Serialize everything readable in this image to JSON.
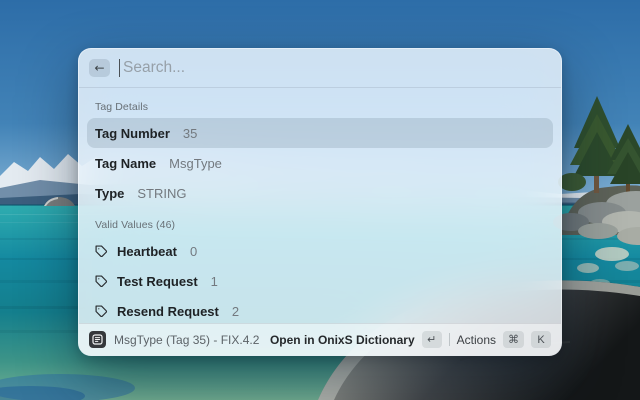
{
  "window": {
    "search": {
      "placeholder": "Search..."
    },
    "icons": {
      "back": "←",
      "return_key": "↵",
      "command_key": "⌘"
    },
    "tag_details": {
      "header": "Tag Details",
      "rows": [
        {
          "label": "Tag Number",
          "value": "35"
        },
        {
          "label": "Tag Name",
          "value": "MsgType"
        },
        {
          "label": "Type",
          "value": "STRING"
        }
      ]
    },
    "valid_values": {
      "header": "Valid Values (46)",
      "items": [
        {
          "label": "Heartbeat",
          "value": "0"
        },
        {
          "label": "Test Request",
          "value": "1"
        },
        {
          "label": "Resend Request",
          "value": "2"
        }
      ]
    },
    "footer": {
      "context": "MsgType (Tag 35) - FIX.4.2",
      "primary_action": "Open in OnixS Dictionary",
      "actions_label": "Actions",
      "k_key": "K"
    }
  },
  "colors": {
    "selection": "#bfccd6",
    "panel_tint": "#f3f8fc",
    "sky": "#2e6fa9",
    "water_teal": "#1489a0",
    "footer_icon_bg": "#35383b"
  }
}
